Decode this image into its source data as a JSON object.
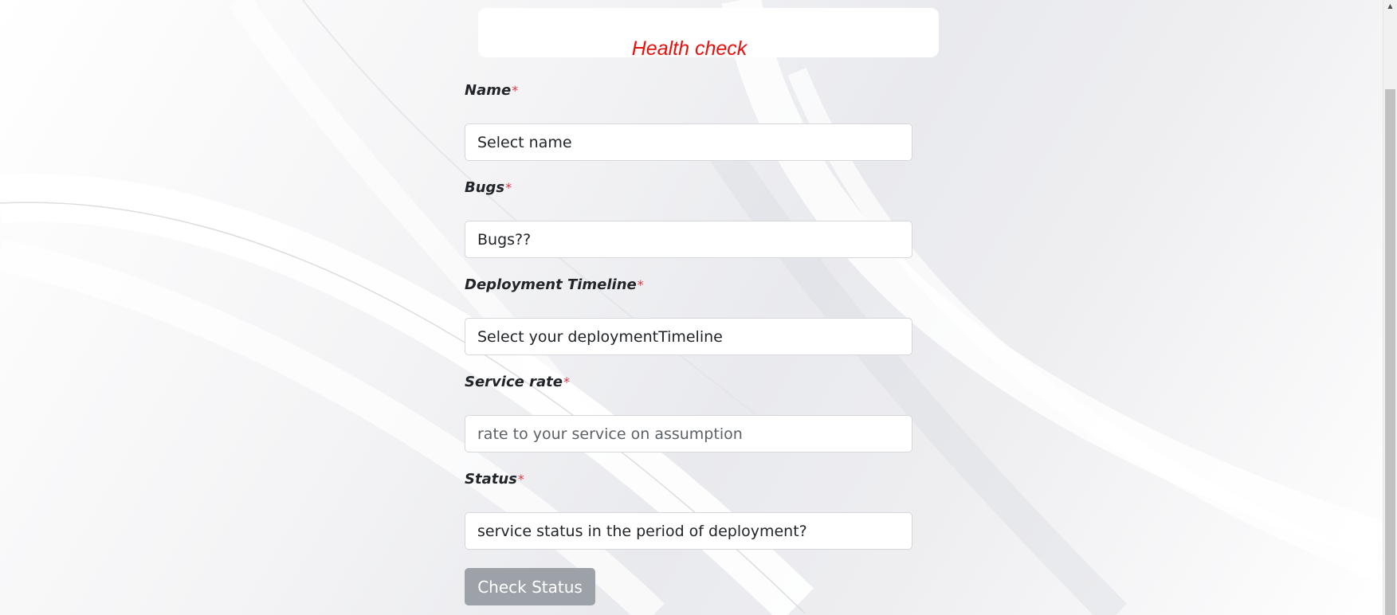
{
  "form": {
    "title": "Health check",
    "required_marker": "*",
    "fields": [
      {
        "label": "Name",
        "value": "Select name",
        "placeholder": ""
      },
      {
        "label": "Bugs",
        "value": "Bugs??",
        "placeholder": ""
      },
      {
        "label": "Deployment Timeline",
        "value": "Select your deploymentTimeline",
        "placeholder": ""
      },
      {
        "label": "Service rate",
        "value": "",
        "placeholder": "rate to your service on assumption"
      },
      {
        "label": "Status",
        "value": "service status in the period of deployment?",
        "placeholder": ""
      }
    ],
    "submit_label": "Check Status"
  },
  "colors": {
    "title": "#e8100c",
    "required_marker": "#dc3545",
    "button_background": "#9da2a8"
  },
  "icons": {
    "scroll_up": "triangle-up-icon"
  }
}
